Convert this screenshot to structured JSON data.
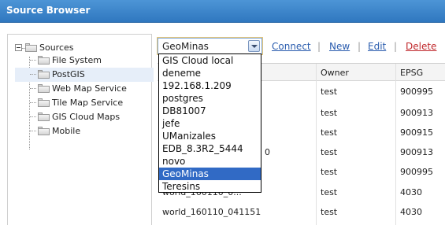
{
  "window": {
    "title": "Source Browser"
  },
  "tree": {
    "root": {
      "label": "Sources",
      "icon": "folder-icon"
    },
    "items": [
      {
        "label": "File System",
        "selected": false
      },
      {
        "label": "PostGIS",
        "selected": true
      },
      {
        "label": "Web Map Service",
        "selected": false
      },
      {
        "label": "Tile Map Service",
        "selected": false
      },
      {
        "label": "GIS Cloud Maps",
        "selected": false
      },
      {
        "label": "Mobile",
        "selected": false
      }
    ]
  },
  "toolbar": {
    "select_value": "GeoMinas",
    "connect_label": "Connect",
    "new_label": "New",
    "edit_label": "Edit",
    "delete_label": "Delete",
    "separator": "|"
  },
  "dropdown": {
    "options": [
      "GIS Cloud local",
      "deneme",
      "192.168.1.209",
      "postgres",
      "DB81007",
      "jefe",
      "UManizales",
      "EDB_8.3R2_5444",
      "novo",
      "GeoMinas",
      "Teresins"
    ],
    "selected_index": 9
  },
  "table": {
    "headers": {
      "owner": "Owner",
      "epsg": "EPSG"
    },
    "rows": [
      {
        "name": "",
        "owner": "test",
        "epsg": "900995"
      },
      {
        "name": "",
        "owner": "test",
        "epsg": "900913"
      },
      {
        "name": "",
        "owner": "test",
        "epsg": "900915"
      },
      {
        "name": "0",
        "owner": "test",
        "epsg": "900913"
      },
      {
        "name": "",
        "owner": "test",
        "epsg": "900995"
      },
      {
        "name": "world_160110_0...",
        "owner": "test",
        "epsg": "4030"
      },
      {
        "name": "world_160110_041151",
        "owner": "test",
        "epsg": "4030"
      }
    ]
  },
  "colors": {
    "titlebar": "#3a84cc",
    "link": "#2a5cae",
    "delete_link": "#c0282c",
    "selected_option": "#316ac5"
  }
}
